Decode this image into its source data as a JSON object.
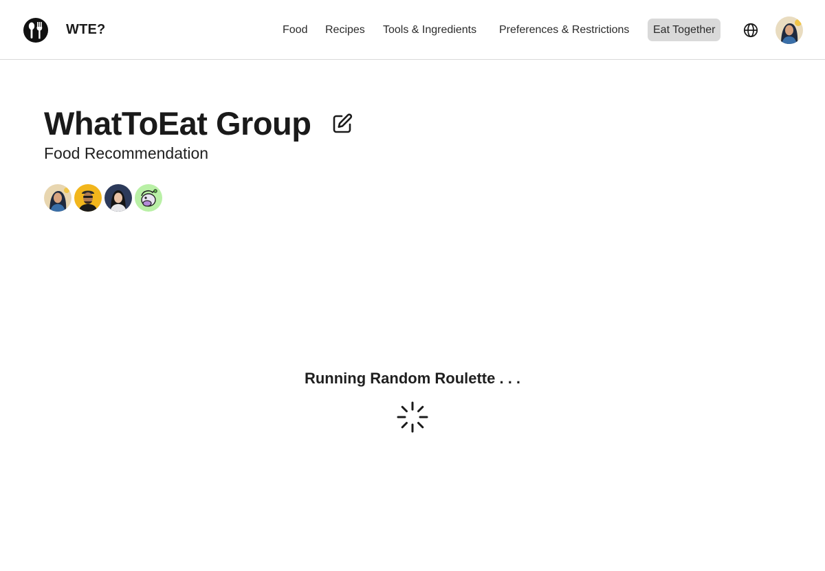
{
  "header": {
    "brand": "WTE?",
    "nav": [
      {
        "label": "Food"
      },
      {
        "label": "Recipes"
      },
      {
        "label": "Tools & Ingredients"
      },
      {
        "label": "Preferences & Restrictions"
      },
      {
        "label": "Eat Together",
        "active": true
      }
    ],
    "icons": {
      "logo": "utensils-logo-icon",
      "language": "globe-icon",
      "profile": "user-avatar"
    }
  },
  "group": {
    "title": "WhatToEat Group",
    "subtitle": "Food Recommendation",
    "edit_icon": "edit-icon",
    "members": [
      {
        "avatar": "member-avatar-1",
        "bg": "#e8d6b0"
      },
      {
        "avatar": "member-avatar-2",
        "bg": "#f2b61c"
      },
      {
        "avatar": "member-avatar-3",
        "bg": "#2c3a5a"
      },
      {
        "avatar": "member-avatar-4",
        "bg": "#b9f0a6"
      }
    ]
  },
  "status": {
    "message": "Running Random Roulette . . .",
    "spinner_icon": "loading-spinner-icon"
  },
  "colors": {
    "active_nav_bg": "#d9d9d9",
    "text": "#1a1a1a"
  }
}
